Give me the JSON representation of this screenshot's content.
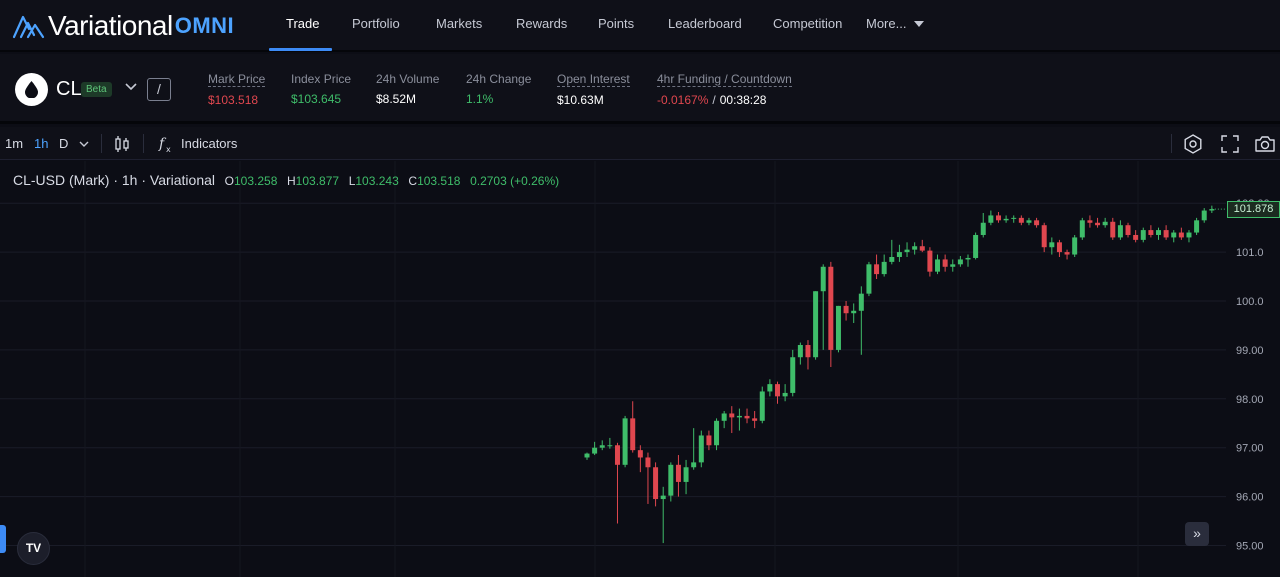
{
  "brand": {
    "name": "Variational",
    "suffix": "OMNI",
    "color": "#4da3ff"
  },
  "nav": {
    "items": [
      "Trade",
      "Portfolio",
      "Markets",
      "Rewards",
      "Points",
      "Leaderboard",
      "Competition",
      "More..."
    ],
    "active": "Trade"
  },
  "market": {
    "symbol": "CL",
    "badge": "Beta",
    "slash": "/",
    "mark_price": {
      "label": "Mark Price",
      "value": "$103.518"
    },
    "index_price": {
      "label": "Index Price",
      "value": "$103.645"
    },
    "volume": {
      "label": "24h Volume",
      "value": "$8.52M"
    },
    "change": {
      "label": "24h Change",
      "value": "1.1%"
    },
    "open_interest": {
      "label": "Open Interest",
      "value": "$10.63M"
    },
    "funding": {
      "label": "4hr Funding / Countdown",
      "rate": "-0.0167%",
      "countdown": "00:38:28"
    }
  },
  "toolbar": {
    "intervals": [
      "1m",
      "1h",
      "D"
    ],
    "active_interval": "1h",
    "indicators_label": "Indicators"
  },
  "legend": {
    "title": "CL-USD (Mark) · 1h · Variational",
    "o_key": "O",
    "o": "103.258",
    "h_key": "H",
    "h": "103.877",
    "l_key": "L",
    "l": "103.243",
    "c_key": "C",
    "c": "103.518",
    "change": "0.2703 (+0.26%)"
  },
  "last_price_label": "101.878",
  "tv_logo": "TV",
  "colors": {
    "up": "#3fbd6a",
    "down": "#e0474f",
    "accent": "#3d8bf5",
    "background": "#0c0d15"
  },
  "chart_data": {
    "type": "candlestick",
    "title": "CL-USD (Mark) · 1h · Variational",
    "y_axis_ticks": [
      "102.00",
      "101.0",
      "100.0",
      "99.00",
      "98.00",
      "97.00",
      "96.00",
      "95.00"
    ],
    "ylim": [
      94.85,
      102.5
    ],
    "grid": true,
    "last_price": 101.878,
    "candles": [
      {
        "o": 96.8,
        "h": 96.9,
        "l": 96.75,
        "c": 96.88
      },
      {
        "o": 96.88,
        "h": 97.12,
        "l": 96.85,
        "c": 97.0
      },
      {
        "o": 97.0,
        "h": 97.15,
        "l": 96.95,
        "c": 97.05
      },
      {
        "o": 97.05,
        "h": 97.2,
        "l": 96.98,
        "c": 97.05
      },
      {
        "o": 97.05,
        "h": 97.1,
        "l": 95.45,
        "c": 96.65
      },
      {
        "o": 96.65,
        "h": 97.65,
        "l": 96.6,
        "c": 97.6
      },
      {
        "o": 97.6,
        "h": 97.95,
        "l": 96.9,
        "c": 96.95
      },
      {
        "o": 96.95,
        "h": 97.05,
        "l": 96.5,
        "c": 96.8
      },
      {
        "o": 96.8,
        "h": 96.9,
        "l": 95.85,
        "c": 96.6
      },
      {
        "o": 96.6,
        "h": 96.7,
        "l": 95.8,
        "c": 95.95
      },
      {
        "o": 95.95,
        "h": 96.2,
        "l": 95.05,
        "c": 96.02
      },
      {
        "o": 96.02,
        "h": 96.7,
        "l": 95.9,
        "c": 96.65
      },
      {
        "o": 96.65,
        "h": 96.85,
        "l": 96.0,
        "c": 96.3
      },
      {
        "o": 96.3,
        "h": 96.75,
        "l": 96.05,
        "c": 96.6
      },
      {
        "o": 96.6,
        "h": 97.4,
        "l": 96.55,
        "c": 96.7
      },
      {
        "o": 96.7,
        "h": 97.35,
        "l": 96.6,
        "c": 97.25
      },
      {
        "o": 97.25,
        "h": 97.35,
        "l": 96.95,
        "c": 97.05
      },
      {
        "o": 97.05,
        "h": 97.6,
        "l": 96.95,
        "c": 97.55
      },
      {
        "o": 97.55,
        "h": 97.75,
        "l": 97.4,
        "c": 97.7
      },
      {
        "o": 97.7,
        "h": 97.85,
        "l": 97.3,
        "c": 97.62
      },
      {
        "o": 97.62,
        "h": 97.8,
        "l": 97.35,
        "c": 97.65
      },
      {
        "o": 97.65,
        "h": 97.8,
        "l": 97.5,
        "c": 97.6
      },
      {
        "o": 97.6,
        "h": 97.75,
        "l": 97.4,
        "c": 97.55
      },
      {
        "o": 97.55,
        "h": 98.25,
        "l": 97.5,
        "c": 98.15
      },
      {
        "o": 98.15,
        "h": 98.4,
        "l": 98.05,
        "c": 98.3
      },
      {
        "o": 98.3,
        "h": 98.35,
        "l": 97.9,
        "c": 98.05
      },
      {
        "o": 98.05,
        "h": 98.3,
        "l": 97.95,
        "c": 98.12
      },
      {
        "o": 98.12,
        "h": 99.0,
        "l": 98.05,
        "c": 98.85
      },
      {
        "o": 98.85,
        "h": 99.15,
        "l": 98.7,
        "c": 99.1
      },
      {
        "o": 99.1,
        "h": 99.2,
        "l": 98.6,
        "c": 98.85
      },
      {
        "o": 98.85,
        "h": 100.2,
        "l": 98.8,
        "c": 100.2
      },
      {
        "o": 100.2,
        "h": 100.75,
        "l": 99.0,
        "c": 100.7
      },
      {
        "o": 100.7,
        "h": 100.8,
        "l": 98.65,
        "c": 99.0
      },
      {
        "o": 99.0,
        "h": 99.9,
        "l": 98.95,
        "c": 99.9
      },
      {
        "o": 99.9,
        "h": 100.0,
        "l": 99.6,
        "c": 99.75
      },
      {
        "o": 99.75,
        "h": 99.95,
        "l": 99.55,
        "c": 99.8
      },
      {
        "o": 99.8,
        "h": 100.3,
        "l": 98.9,
        "c": 100.15
      },
      {
        "o": 100.15,
        "h": 100.8,
        "l": 100.1,
        "c": 100.75
      },
      {
        "o": 100.75,
        "h": 100.95,
        "l": 100.45,
        "c": 100.55
      },
      {
        "o": 100.55,
        "h": 100.95,
        "l": 100.5,
        "c": 100.8
      },
      {
        "o": 100.8,
        "h": 101.25,
        "l": 100.75,
        "c": 100.9
      },
      {
        "o": 100.9,
        "h": 101.15,
        "l": 100.8,
        "c": 101.0
      },
      {
        "o": 101.0,
        "h": 101.2,
        "l": 100.9,
        "c": 101.05
      },
      {
        "o": 101.05,
        "h": 101.2,
        "l": 100.95,
        "c": 101.12
      },
      {
        "o": 101.12,
        "h": 101.25,
        "l": 101.0,
        "c": 101.03
      },
      {
        "o": 101.03,
        "h": 101.1,
        "l": 100.5,
        "c": 100.6
      },
      {
        "o": 100.6,
        "h": 100.95,
        "l": 100.55,
        "c": 100.85
      },
      {
        "o": 100.85,
        "h": 100.95,
        "l": 100.6,
        "c": 100.7
      },
      {
        "o": 100.7,
        "h": 100.85,
        "l": 100.6,
        "c": 100.75
      },
      {
        "o": 100.75,
        "h": 100.92,
        "l": 100.7,
        "c": 100.85
      },
      {
        "o": 100.85,
        "h": 100.95,
        "l": 100.7,
        "c": 100.88
      },
      {
        "o": 100.88,
        "h": 101.4,
        "l": 100.85,
        "c": 101.35
      },
      {
        "o": 101.35,
        "h": 101.8,
        "l": 101.3,
        "c": 101.6
      },
      {
        "o": 101.6,
        "h": 101.85,
        "l": 101.55,
        "c": 101.75
      },
      {
        "o": 101.75,
        "h": 101.82,
        "l": 101.6,
        "c": 101.65
      },
      {
        "o": 101.65,
        "h": 101.75,
        "l": 101.6,
        "c": 101.68
      },
      {
        "o": 101.68,
        "h": 101.75,
        "l": 101.6,
        "c": 101.7
      },
      {
        "o": 101.7,
        "h": 101.75,
        "l": 101.55,
        "c": 101.6
      },
      {
        "o": 101.6,
        "h": 101.7,
        "l": 101.55,
        "c": 101.65
      },
      {
        "o": 101.65,
        "h": 101.7,
        "l": 101.5,
        "c": 101.55
      },
      {
        "o": 101.55,
        "h": 101.6,
        "l": 101.0,
        "c": 101.1
      },
      {
        "o": 101.1,
        "h": 101.3,
        "l": 100.95,
        "c": 101.2
      },
      {
        "o": 101.2,
        "h": 101.25,
        "l": 100.9,
        "c": 101.0
      },
      {
        "o": 101.0,
        "h": 101.05,
        "l": 100.85,
        "c": 100.95
      },
      {
        "o": 100.95,
        "h": 101.35,
        "l": 100.9,
        "c": 101.3
      },
      {
        "o": 101.3,
        "h": 101.7,
        "l": 101.25,
        "c": 101.65
      },
      {
        "o": 101.65,
        "h": 101.75,
        "l": 101.5,
        "c": 101.6
      },
      {
        "o": 101.6,
        "h": 101.7,
        "l": 101.5,
        "c": 101.55
      },
      {
        "o": 101.55,
        "h": 101.7,
        "l": 101.5,
        "c": 101.62
      },
      {
        "o": 101.62,
        "h": 101.7,
        "l": 101.25,
        "c": 101.3
      },
      {
        "o": 101.3,
        "h": 101.65,
        "l": 101.25,
        "c": 101.55
      },
      {
        "o": 101.55,
        "h": 101.6,
        "l": 101.3,
        "c": 101.35
      },
      {
        "o": 101.35,
        "h": 101.45,
        "l": 101.2,
        "c": 101.25
      },
      {
        "o": 101.25,
        "h": 101.5,
        "l": 101.2,
        "c": 101.45
      },
      {
        "o": 101.45,
        "h": 101.55,
        "l": 101.3,
        "c": 101.35
      },
      {
        "o": 101.35,
        "h": 101.5,
        "l": 101.25,
        "c": 101.45
      },
      {
        "o": 101.45,
        "h": 101.55,
        "l": 101.25,
        "c": 101.3
      },
      {
        "o": 101.3,
        "h": 101.45,
        "l": 101.2,
        "c": 101.4
      },
      {
        "o": 101.4,
        "h": 101.5,
        "l": 101.25,
        "c": 101.3
      },
      {
        "o": 101.3,
        "h": 101.45,
        "l": 101.2,
        "c": 101.4
      },
      {
        "o": 101.4,
        "h": 101.7,
        "l": 101.35,
        "c": 101.65
      },
      {
        "o": 101.65,
        "h": 101.9,
        "l": 101.6,
        "c": 101.85
      },
      {
        "o": 101.85,
        "h": 101.95,
        "l": 101.8,
        "c": 101.88
      }
    ]
  }
}
